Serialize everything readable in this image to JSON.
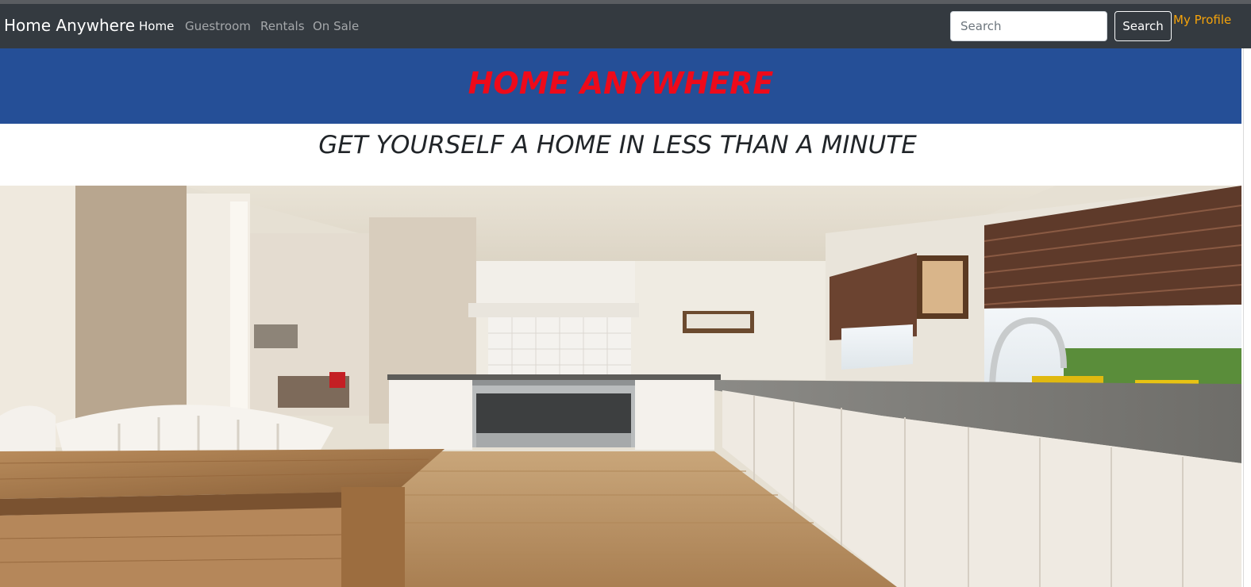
{
  "navbar": {
    "brand": "Home Anywhere",
    "links": [
      {
        "label": "Home",
        "active": true
      },
      {
        "label": "Guestroom",
        "active": false
      },
      {
        "label": "Rentals",
        "active": false
      },
      {
        "label": "On Sale",
        "active": false
      }
    ],
    "search": {
      "placeholder": "Search",
      "value": "",
      "button_label": "Search"
    },
    "profile_label": "My Profile"
  },
  "hero": {
    "title": "HOME ANYWHERE",
    "tagline": "GET YOURSELF A HOME IN LESS THAN A MINUTE"
  },
  "colors": {
    "navbar_bg": "#343a40",
    "hero_bg": "#254f97",
    "title_color": "#ee0a1a",
    "profile_link": "#f5a30a"
  }
}
